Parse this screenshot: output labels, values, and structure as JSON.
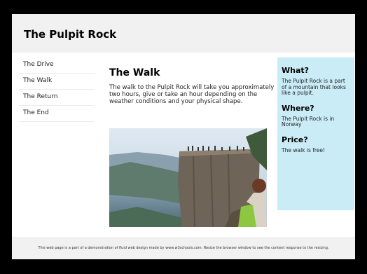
{
  "header": {
    "title": "The Pulpit Rock"
  },
  "nav": {
    "items": [
      {
        "label": "The Drive"
      },
      {
        "label": "The Walk"
      },
      {
        "label": "The Return"
      },
      {
        "label": "The End"
      }
    ]
  },
  "main": {
    "heading": "The Walk",
    "text": "The walk to the Pulpit Rock will take you approximately two hours, give or take an hour depending on the weather conditions and your physical shape."
  },
  "aside": {
    "sections": [
      {
        "heading": "What?",
        "text": "The Pulpit Rock is a part of a mountain that looks like a pulpit."
      },
      {
        "heading": "Where?",
        "text": "The Pulpit Rock is in Norway"
      },
      {
        "heading": "Price?",
        "text": "The walk is free!"
      }
    ]
  },
  "footer": {
    "text": "This web page is a part of a demonstration of fluid web design made by www.w3schools.com. Resize the browser window to see the content response to the resizing."
  },
  "colors": {
    "aside_bg": "#c9ecf7",
    "header_bg": "#f1f1f1",
    "frame_bg": "#000000"
  }
}
